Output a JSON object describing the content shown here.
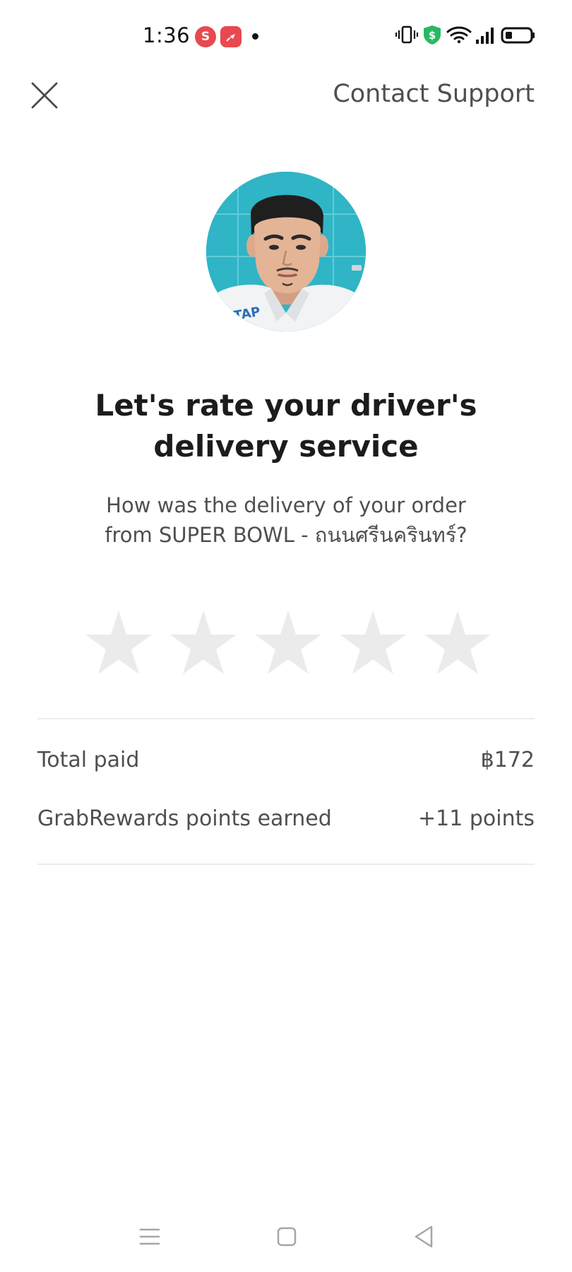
{
  "status_bar": {
    "time": "1:36",
    "notification_icons": [
      "s-app-icon",
      "pin-app-icon"
    ],
    "system_icons": [
      "vibrate-icon",
      "shield-icon",
      "wifi-icon",
      "signal-icon",
      "battery-icon"
    ],
    "s_letter": "S"
  },
  "header": {
    "close_icon": "close-icon",
    "contact_support": "Contact Support"
  },
  "driver": {
    "avatar": "driver-photo"
  },
  "rating": {
    "title_line1": "Let's rate your driver's",
    "title_line2": "delivery service",
    "subtitle_line1": "How was the delivery of your order",
    "subtitle_line2": "from SUPER BOWL - ถนนศรีนครินทร์?",
    "stars_total": 5,
    "stars_selected": 0,
    "star_color": "#ebebeb"
  },
  "summary": {
    "total_paid_label": "Total paid",
    "total_paid_value": "฿172",
    "points_label": "GrabRewards points earned",
    "points_value": "+11 points"
  },
  "nav_bar": {
    "buttons": [
      "menu-icon",
      "home-icon",
      "back-icon"
    ]
  },
  "colors": {
    "text_primary": "#1c1c1c",
    "text_secondary": "#4f4f4f",
    "divider": "#ececec",
    "notif_red": "#e8494f",
    "shield_green": "#27b864"
  }
}
